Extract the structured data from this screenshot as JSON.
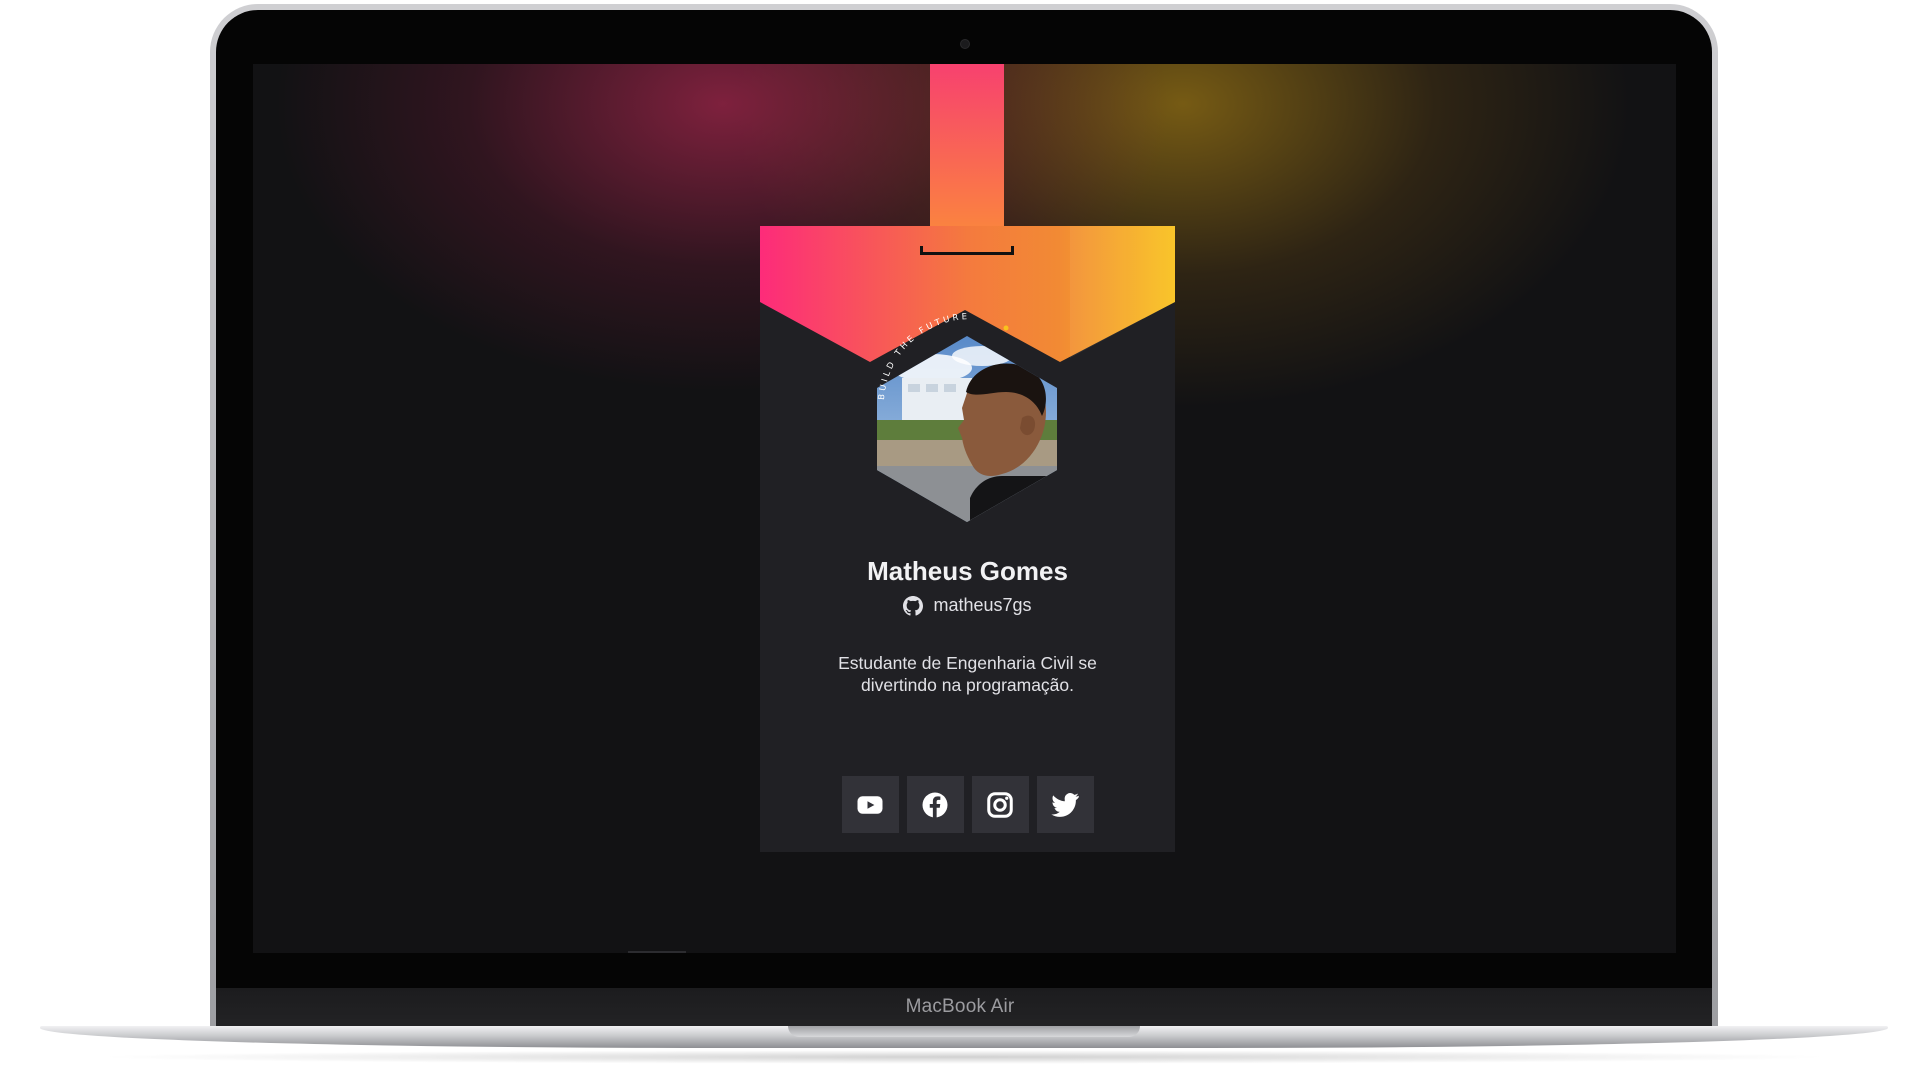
{
  "device": {
    "model_label": "MacBook Air"
  },
  "profile": {
    "name": "Matheus Gomes",
    "github_username": "matheus7gs",
    "bio": "Estudante de Engenharia Civil se divertindo na programação.",
    "ring_text": "BUILD THE FUTURE"
  },
  "socials": [
    {
      "network": "YouTube",
      "icon": "youtube-icon"
    },
    {
      "network": "Facebook",
      "icon": "facebook-icon"
    },
    {
      "network": "Instagram",
      "icon": "instagram-icon"
    },
    {
      "network": "Twitter",
      "icon": "twitter-icon"
    }
  ],
  "colors": {
    "screen_background": "#121214",
    "card_background": "#202024",
    "button_background": "#323238",
    "gradient_pink": "#fd2b7a",
    "gradient_orange": "#f28a34",
    "gradient_yellow": "#f9c21d",
    "text_primary": "#f2f2f4"
  }
}
